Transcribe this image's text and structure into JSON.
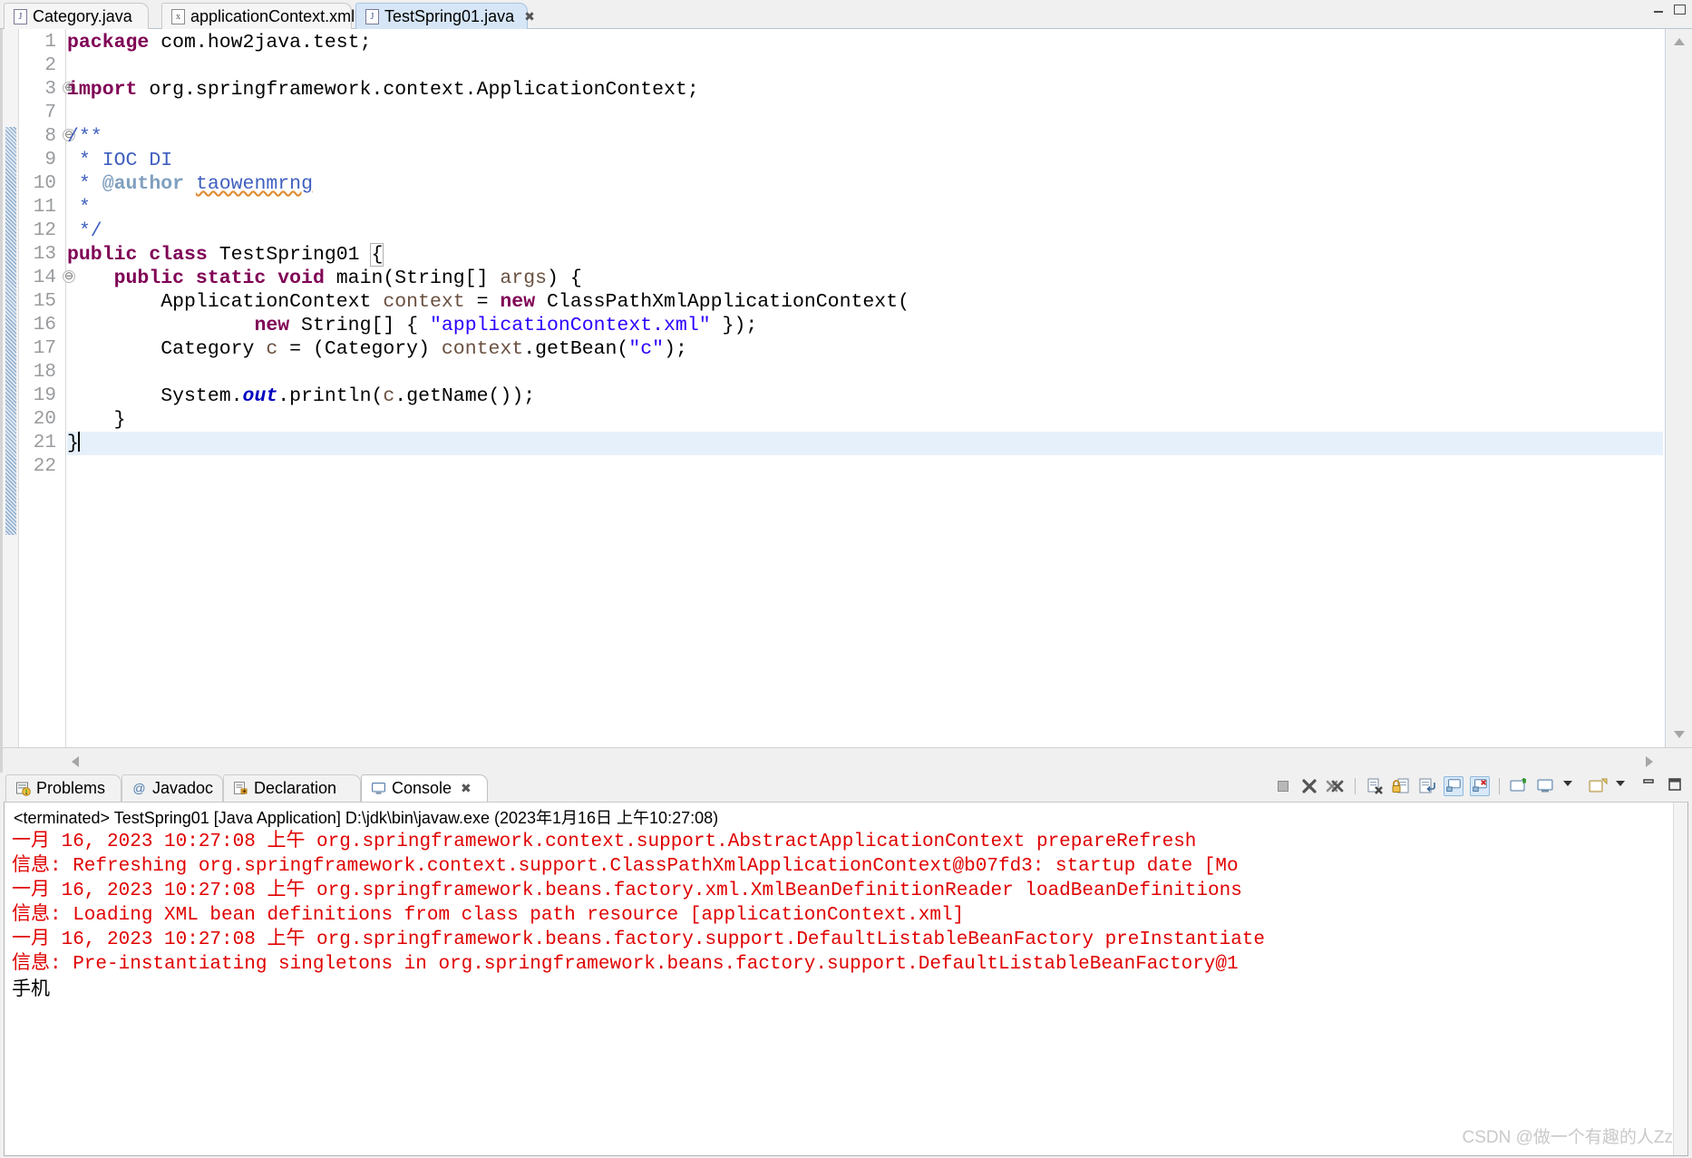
{
  "window": {
    "minimize_label": "Minimize",
    "maximize_label": "Maximize"
  },
  "editor_tabs": [
    {
      "label": "Category.java",
      "icon": "java-file-icon",
      "active": false,
      "closable": false
    },
    {
      "label": "applicationContext.xml",
      "icon": "xml-file-icon",
      "active": false,
      "closable": false
    },
    {
      "label": "TestSpring01.java",
      "icon": "java-file-icon",
      "active": true,
      "closable": true,
      "close_glyph": "✖"
    }
  ],
  "editor": {
    "line_numbers": [
      "1",
      "2",
      "3",
      "7",
      "8",
      "9",
      "10",
      "11",
      "12",
      "13",
      "14",
      "15",
      "16",
      "17",
      "18",
      "19",
      "20",
      "21",
      "22"
    ],
    "current_line_number": "21",
    "fold_markers": [
      {
        "line": "3",
        "glyph": "⊕"
      },
      {
        "line": "8",
        "glyph": "⊖"
      },
      {
        "line": "14",
        "glyph": "⊖"
      }
    ],
    "code_lines": [
      "package com.how2java.test;",
      "",
      "import org.springframework.context.ApplicationContext;",
      "",
      "/**",
      " * IOC DI",
      " * @author taowenmrng",
      " *",
      " */",
      "public class TestSpring01 {",
      "    public static void main(String[] args) {",
      "        ApplicationContext context = new ClassPathXmlApplicationContext(",
      "                new String[] { \"applicationContext.xml\" });",
      "        Category c = (Category) context.getBean(\"c\");",
      "",
      "        System.out.println(c.getName());",
      "    }",
      "}",
      ""
    ],
    "tokens": {
      "keywords": [
        "package",
        "import",
        "public",
        "class",
        "static",
        "void",
        "new"
      ],
      "javadoc_tag": "@author",
      "javadoc_link": "taowenmrng",
      "string_literals": [
        "\"applicationContext.xml\"",
        "\"c\""
      ],
      "static_field": "out",
      "local_vars": [
        "args",
        "context",
        "c"
      ]
    },
    "scroll": {
      "v_up_arrow": "scroll-up",
      "v_down_arrow": "scroll-down",
      "h_left_arrow": "scroll-left",
      "h_right_arrow": "scroll-right"
    }
  },
  "bottom_panel": {
    "tabs": [
      {
        "label": "Problems",
        "icon": "problems-icon",
        "active": false,
        "closable": false
      },
      {
        "label": "Javadoc",
        "icon": "javadoc-icon",
        "active": false,
        "closable": false
      },
      {
        "label": "Declaration",
        "icon": "declaration-icon",
        "active": false,
        "closable": false
      },
      {
        "label": "Console",
        "icon": "console-icon",
        "active": true,
        "closable": true,
        "close_glyph": "✖"
      }
    ],
    "toolbar": [
      {
        "name": "terminate-button",
        "glyph": "■",
        "enabled": false
      },
      {
        "name": "remove-launch-button",
        "glyph": "✖",
        "enabled": true
      },
      {
        "name": "remove-all-terminated-button",
        "glyph": "✖✖",
        "enabled": true
      },
      {
        "name": "clear-console-button",
        "glyph": "🗎",
        "enabled": true
      },
      {
        "name": "scroll-lock-button",
        "glyph": "🔒",
        "enabled": true
      },
      {
        "name": "word-wrap-button",
        "glyph": "↵",
        "enabled": true
      },
      {
        "name": "show-console-on-output-button",
        "glyph": "🖥",
        "enabled": true,
        "toggled": true
      },
      {
        "name": "show-console-on-error-button",
        "glyph": "🖥",
        "enabled": true,
        "toggled": true
      },
      {
        "name": "pin-console-button",
        "glyph": "📌",
        "enabled": true
      },
      {
        "name": "display-selected-console-button",
        "glyph": "🖥",
        "enabled": true
      },
      {
        "name": "display-selected-console-dropdown",
        "glyph": "▼",
        "enabled": true
      },
      {
        "name": "open-console-button",
        "glyph": "🗒",
        "enabled": true
      },
      {
        "name": "open-console-dropdown",
        "glyph": "▼",
        "enabled": true
      },
      {
        "name": "minimize-panel-button",
        "glyph": "—",
        "enabled": true
      },
      {
        "name": "maximize-panel-button",
        "glyph": "□",
        "enabled": true
      }
    ],
    "process_line": "<terminated> TestSpring01 [Java Application] D:\\jdk\\bin\\javaw.exe (2023年1月16日 上午10:27:08)",
    "output": [
      {
        "text": "一月 16, 2023 10:27:08 上午 org.springframework.context.support.AbstractApplicationContext prepareRefresh",
        "stream": "err"
      },
      {
        "text": "信息: Refreshing org.springframework.context.support.ClassPathXmlApplicationContext@b07fd3: startup date [Mo",
        "stream": "err"
      },
      {
        "text": "一月 16, 2023 10:27:08 上午 org.springframework.beans.factory.xml.XmlBeanDefinitionReader loadBeanDefinitions",
        "stream": "err"
      },
      {
        "text": "信息: Loading XML bean definitions from class path resource [applicationContext.xml]",
        "stream": "err"
      },
      {
        "text": "一月 16, 2023 10:27:08 上午 org.springframework.beans.factory.support.DefaultListableBeanFactory preInstantiate",
        "stream": "err"
      },
      {
        "text": "信息: Pre-instantiating singletons in org.springframework.beans.factory.support.DefaultListableBeanFactory@1",
        "stream": "err"
      },
      {
        "text": "手机",
        "stream": "out"
      }
    ]
  },
  "watermark": "CSDN @做一个有趣的人Zz",
  "colors": {
    "keyword": "#7F0055",
    "string": "#2A00FF",
    "comment": "#3F5FBF",
    "javadoc_tag": "#7F9FBF",
    "local_var": "#6A5040",
    "static_field": "#0000C0",
    "console_err": "#E00000",
    "active_tab_bg": "#D6E6F7",
    "current_line_bg": "#E6F0FB"
  }
}
